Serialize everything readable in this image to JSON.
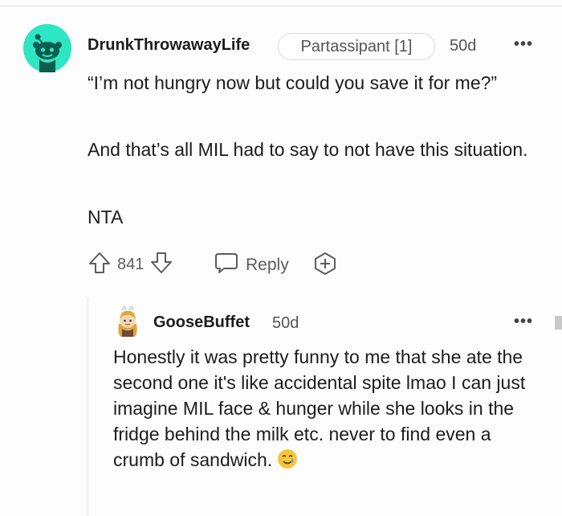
{
  "comment": {
    "author": "DrunkThrowawayLife",
    "flair": "Partassipant [1]",
    "age": "50d",
    "paragraphs": [
      "“I’m not hungry now but could you save it for me?”",
      "And that’s all MIL had to say to not have this situation.",
      "NTA"
    ],
    "score": "841",
    "reply_label": "Reply"
  },
  "reply": {
    "author": "GooseBuffet",
    "age": "50d",
    "body": "Honestly it was pretty funny to me that she ate the second one it's like accidental spite lmao I can just imagine MIL face & hunger while she looks in the fridge behind the milk etc. never to find even a crumb of sandwich.",
    "emoji": "smiling-face-with-tear-icon"
  },
  "colors": {
    "avatar_bg": "#2ee6c4",
    "text": "#1c1c1c",
    "muted": "#5c5c5c"
  }
}
